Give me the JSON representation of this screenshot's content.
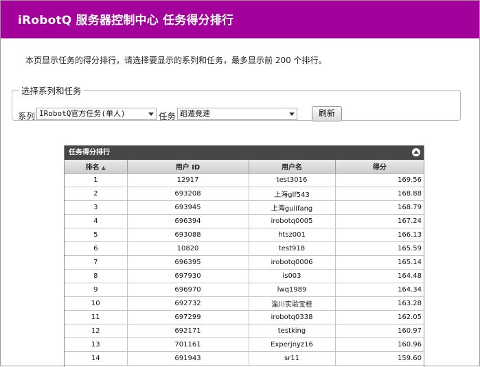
{
  "header": {
    "title": "iRobotQ 服务器控制中心 任务得分排行"
  },
  "intro": "本页显示任务的得分排行，请选择要显示的系列和任务，最多显示前 200 个排行。",
  "selector": {
    "legend": "选择系列和任务",
    "series_label": "系列",
    "series_value": "IRobotQ官方任务(单人)",
    "task_label": "任务",
    "task_value": "蹈遁竟速",
    "refresh_label": "刷新"
  },
  "table": {
    "title": "任务得分排行",
    "columns": [
      "排名",
      "用户 ID",
      "用户名",
      "得分"
    ],
    "rows": [
      [
        "1",
        "12917",
        "test3016",
        "169.56"
      ],
      [
        "2",
        "693208",
        "上海glf543",
        "168.88"
      ],
      [
        "3",
        "693945",
        "上海gulifang",
        "168.79"
      ],
      [
        "4",
        "696394",
        "irobotq0005",
        "167.24"
      ],
      [
        "5",
        "693088",
        "htsz001",
        "166.13"
      ],
      [
        "6",
        "10820",
        "test918",
        "165.59"
      ],
      [
        "7",
        "696395",
        "irobotq0006",
        "165.14"
      ],
      [
        "8",
        "697930",
        "ls003",
        "164.48"
      ],
      [
        "9",
        "696970",
        "lwq1989",
        "164.34"
      ],
      [
        "10",
        "692732",
        "淄川实验宝桂",
        "163.28"
      ],
      [
        "11",
        "697299",
        "irobotq0338",
        "162.05"
      ],
      [
        "12",
        "692171",
        "testking",
        "160.97"
      ],
      [
        "13",
        "701161",
        "Experjnyz16",
        "160.96"
      ],
      [
        "14",
        "691943",
        "sr11",
        "159.60"
      ]
    ]
  }
}
